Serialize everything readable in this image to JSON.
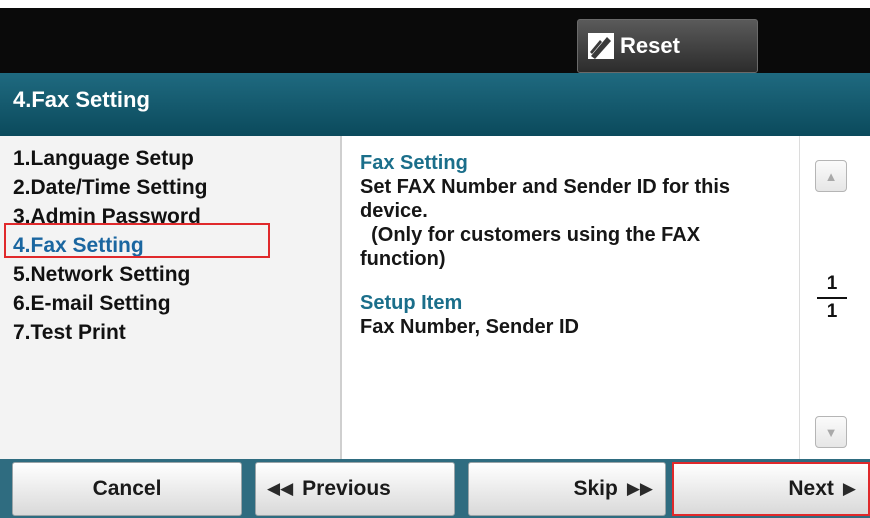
{
  "header": {
    "reset_label": "Reset",
    "reset_icon": "reset-pencil-icon"
  },
  "title": "4.Fax Setting",
  "menu": {
    "items": [
      {
        "label": "1.Language Setup"
      },
      {
        "label": "2.Date/Time Setting"
      },
      {
        "label": "3.Admin Password"
      },
      {
        "label": "4.Fax Setting",
        "selected": true
      },
      {
        "label": "5.Network Setting"
      },
      {
        "label": "6.E-mail Setting"
      },
      {
        "label": "7.Test Print"
      }
    ]
  },
  "description": {
    "heading": "Fax Setting",
    "body": "Set FAX Number and Sender ID for this device.\n  (Only for customers using the FAX function)",
    "setup_heading": "Setup Item",
    "setup_body": "Fax Number, Sender ID"
  },
  "pagination": {
    "current": "1",
    "total": "1"
  },
  "footer": {
    "cancel_label": "Cancel",
    "previous_label": "Previous",
    "skip_label": "Skip",
    "next_label": "Next"
  },
  "colors": {
    "title_bar": "#0b4a5c",
    "selected_text": "#1a66a0",
    "highlight_frame": "#e0292b",
    "footer_bar": "#2f6c80"
  }
}
